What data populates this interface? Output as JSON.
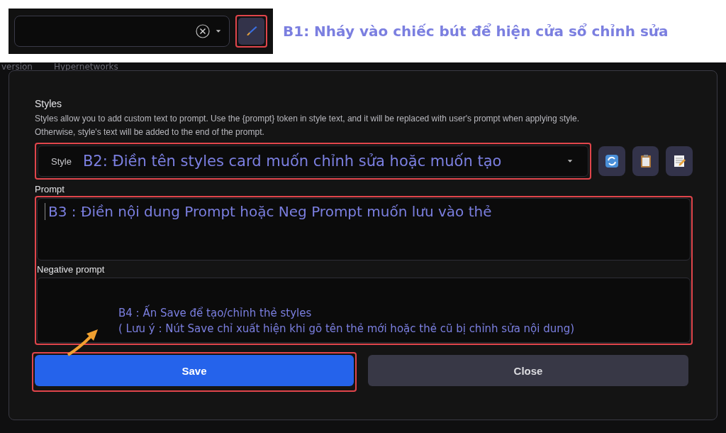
{
  "top_bar": {
    "annotation": "B1: Nháy vào chiếc bút để hiện cửa sổ chỉnh  sửa"
  },
  "background_tabs": [
    "version",
    "Hypernetworks"
  ],
  "dialog": {
    "heading": "Styles",
    "description": "Styles allow you to add custom text to prompt. Use the {prompt} token in style text, and it will be replaced with user's prompt when applying style. Otherwise, style's text will be added to the end of the prompt.",
    "style_label": "Style",
    "style_value": "B2: Điền tên styles card muốn chỉnh sửa hoặc muốn tạo",
    "prompt_label": "Prompt",
    "prompt_value": "B3 : Điền nội dung Prompt hoặc Neg Prompt muốn lưu vào thẻ",
    "negative_label": "Negative prompt",
    "note_lines": [
      "B4 : Ấn Save để tạo/chỉnh thẻ styles",
      "( Lưu ý : Nút Save chỉ xuất hiện khi gõ tên thẻ mới hoặc thẻ cũ bị chỉnh  sửa nội dung)"
    ],
    "buttons": [
      {
        "label": "Save",
        "kind": "primary"
      },
      {
        "label": "Close",
        "kind": "secondary"
      }
    ]
  }
}
